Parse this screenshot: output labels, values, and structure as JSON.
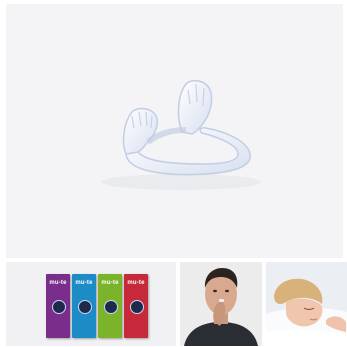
{
  "gallery": {
    "main_image": {
      "icon": "nasal-dilator-product",
      "colors": {
        "background": "#f4f4f6",
        "product": "#dfe7f7"
      }
    },
    "thumbnails": [
      {
        "icon": "product-boxes-photo",
        "boxes": [
          {
            "label": "mu-te",
            "color": "#7a2d8a"
          },
          {
            "label": "mu-te",
            "color": "#1d8cc6"
          },
          {
            "label": "mu-te",
            "color": "#7bb42a"
          },
          {
            "label": "mu-te",
            "color": "#c62a3a"
          }
        ]
      },
      {
        "icon": "man-inserting-device-photo"
      },
      {
        "icon": "woman-sleeping-photo"
      }
    ]
  }
}
